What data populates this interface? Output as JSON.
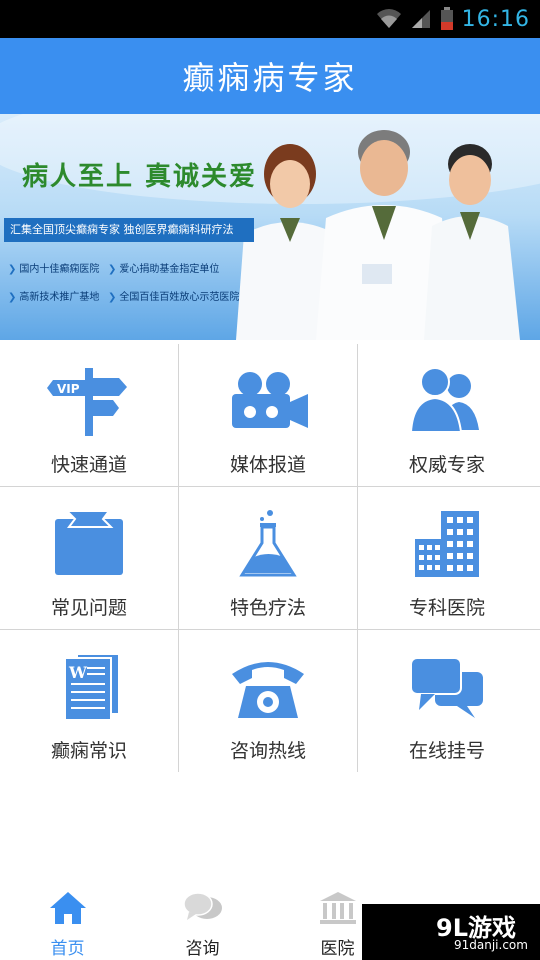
{
  "status_bar": {
    "time": "16:16"
  },
  "header": {
    "title": "癫痫病专家"
  },
  "banner": {
    "slogan": "病人至上  真诚关爱",
    "line": "汇集全国顶尖癫痫专家   独创医界癫痫科研疗法",
    "tags": [
      "国内十佳癫痫医院",
      "爱心捐助基金指定单位",
      "高新技术推广基地",
      "全国百佳百姓放心示范医院"
    ]
  },
  "grid": {
    "items": [
      {
        "label": "快速通道",
        "icon": "vip-signpost-icon"
      },
      {
        "label": "媒体报道",
        "icon": "video-camera-icon"
      },
      {
        "label": "权威专家",
        "icon": "experts-group-icon"
      },
      {
        "label": "常见问题",
        "icon": "notebook-icon"
      },
      {
        "label": "特色疗法",
        "icon": "flask-icon"
      },
      {
        "label": "专科医院",
        "icon": "hospital-building-icon"
      },
      {
        "label": "癫痫常识",
        "icon": "word-document-icon"
      },
      {
        "label": "咨询热线",
        "icon": "telephone-icon"
      },
      {
        "label": "在线挂号",
        "icon": "chat-bubbles-icon"
      }
    ],
    "accent_color": "#3a8ff0"
  },
  "bottom_nav": {
    "items": [
      {
        "label": "首页",
        "icon": "home-icon",
        "active": true
      },
      {
        "label": "咨询",
        "icon": "chat-icon",
        "active": false
      },
      {
        "label": "医院",
        "icon": "bank-building-icon",
        "active": false
      }
    ]
  },
  "watermark": {
    "brand": "9L游戏",
    "site": "91danji.com"
  }
}
